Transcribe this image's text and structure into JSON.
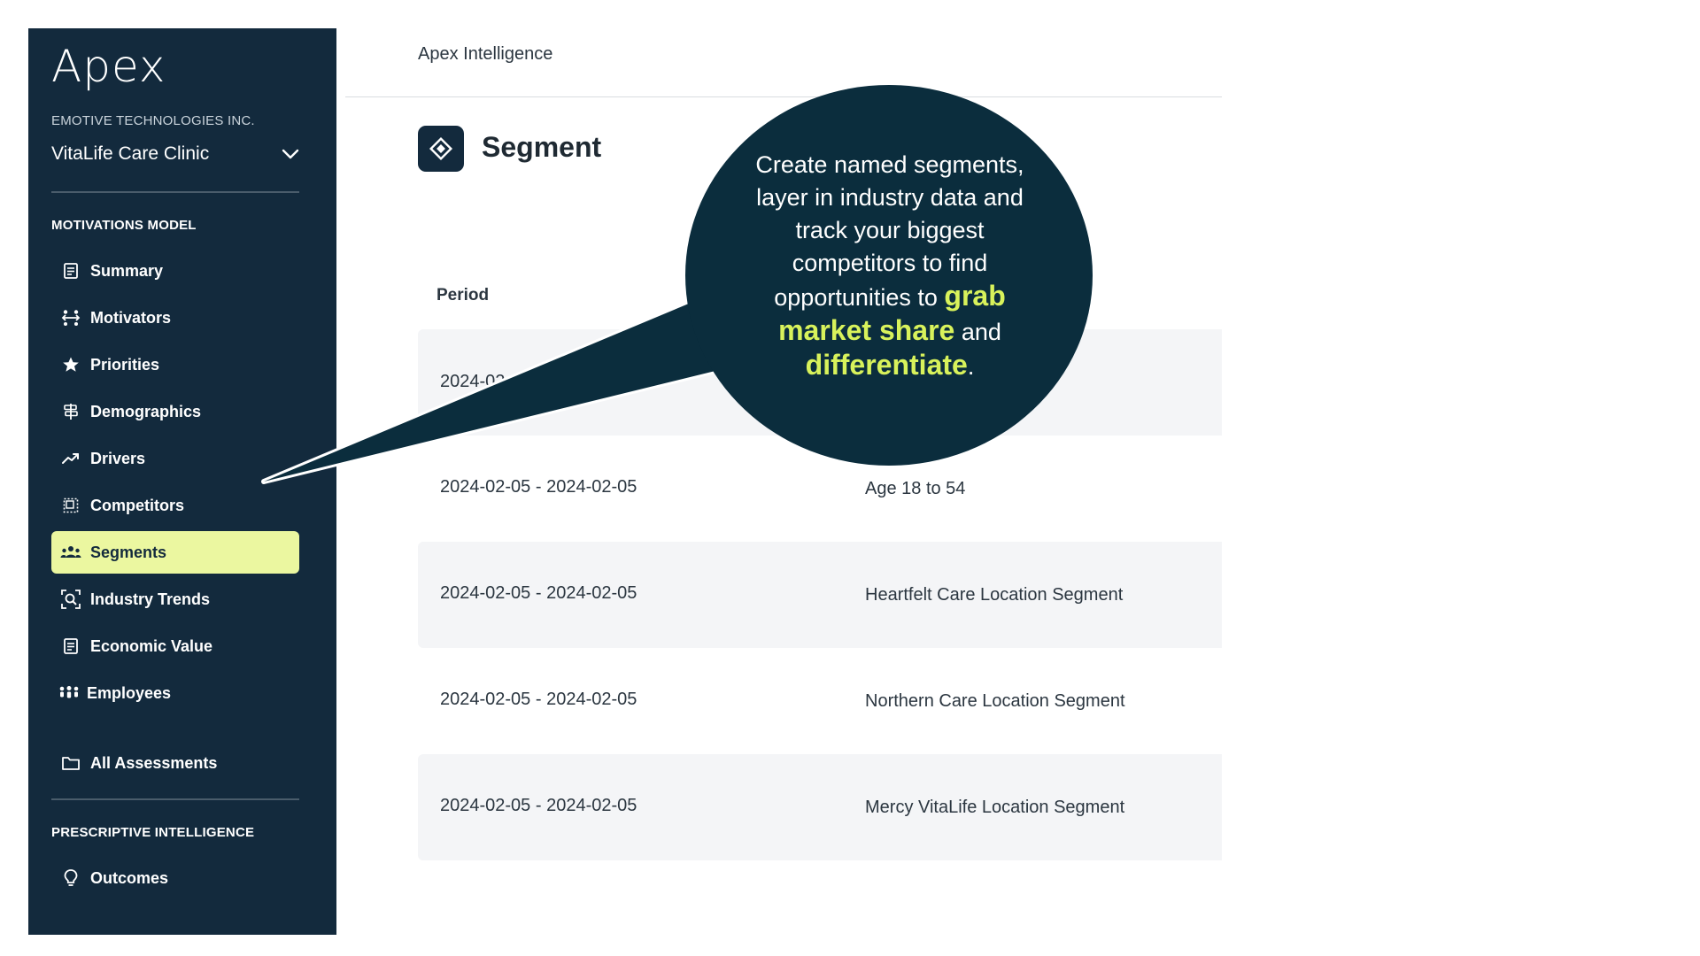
{
  "sidebar": {
    "logo": "Apex",
    "company": "EMOTIVE TECHNOLOGIES INC.",
    "clinic": "VitaLife Care Clinic",
    "section_motivations": "MOTIVATIONS MODEL",
    "items": [
      {
        "label": "Summary",
        "icon": "document-icon"
      },
      {
        "label": "Motivators",
        "icon": "people-arrows-icon"
      },
      {
        "label": "Priorities",
        "icon": "star-icon"
      },
      {
        "label": "Demographics",
        "icon": "signpost-icon"
      },
      {
        "label": "Drivers",
        "icon": "trending-up-icon"
      },
      {
        "label": "Competitors",
        "icon": "dotted-square-icon"
      },
      {
        "label": "Segments",
        "icon": "group-icon"
      },
      {
        "label": "Industry Trends",
        "icon": "scan-search-icon"
      },
      {
        "label": "Economic Value",
        "icon": "document-icon"
      },
      {
        "label": "Employees",
        "icon": "team-icon"
      }
    ],
    "all_assessments": "All Assessments",
    "section_prescriptive": "PRESCRIPTIVE INTELLIGENCE",
    "outcomes": "Outcomes",
    "active_item": "Segments",
    "active_color": "#ebf7a0",
    "bg_color": "#132a3d"
  },
  "main": {
    "app_title": "Apex Intelligence",
    "page_title": "Segment",
    "column_period": "Period",
    "rows": [
      {
        "period": "2024-02-05 - 2024-02-05",
        "name": ""
      },
      {
        "period": "2024-02-05 - 2024-02-05",
        "name": "Age 18 to 54"
      },
      {
        "period": "2024-02-05 - 2024-02-05",
        "name": "Heartfelt Care Location Segment"
      },
      {
        "period": "2024-02-05 - 2024-02-05",
        "name": "Northern Care Location Segment"
      },
      {
        "period": "2024-02-05 - 2024-02-05",
        "name": "Mercy VitaLife Location Segment"
      }
    ]
  },
  "callout": {
    "line1": "Create named segments, layer in industry data and track your biggest competitors to find opportunities to ",
    "hl1": "grab market share",
    "mid": " and ",
    "hl2": "differentiate",
    "end": ".",
    "highlight_color": "#d8f25b"
  }
}
